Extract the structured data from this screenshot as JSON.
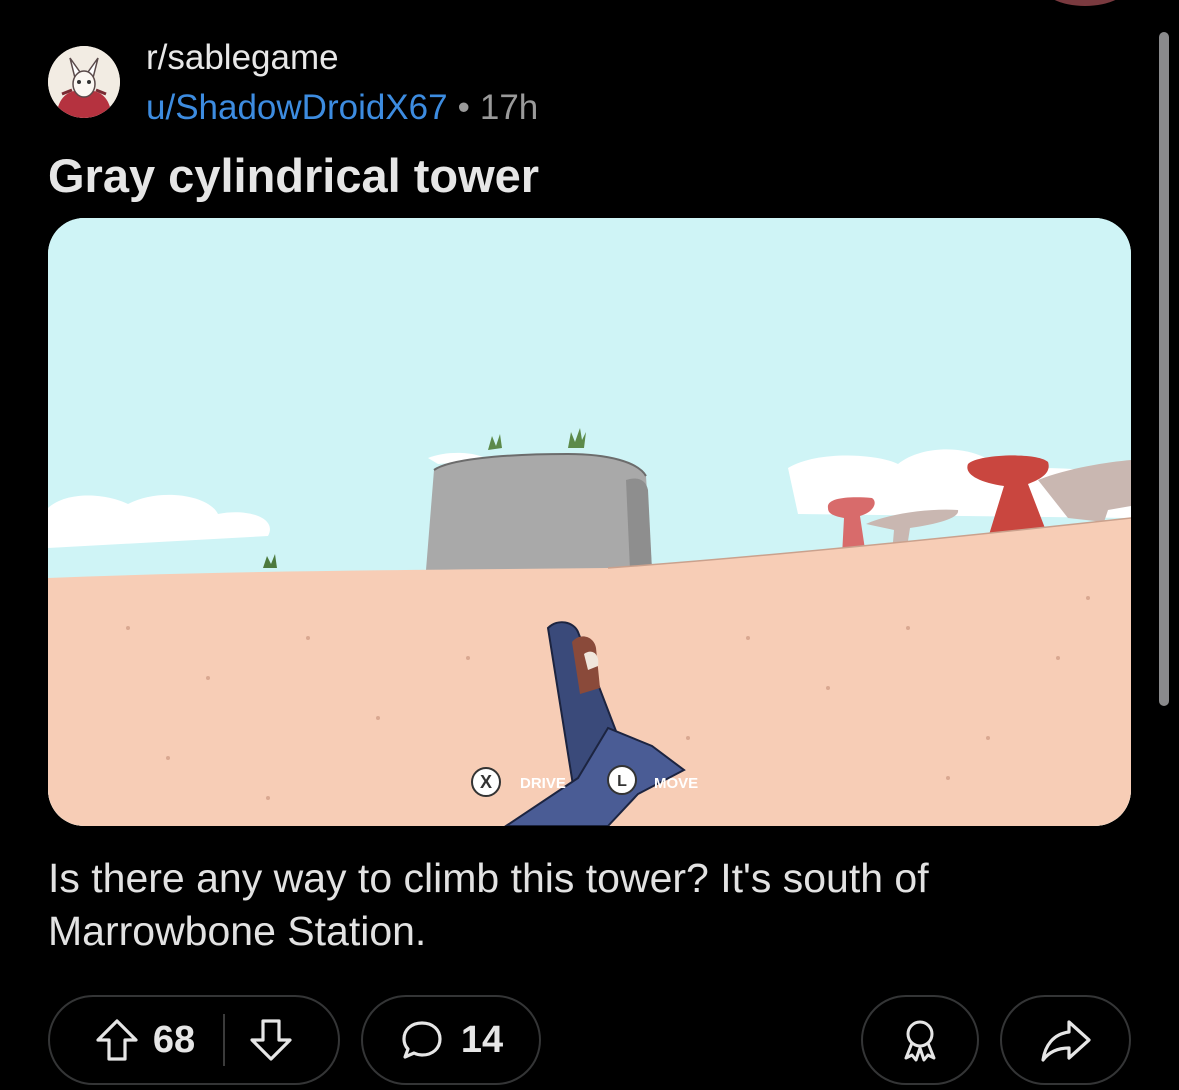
{
  "post": {
    "subreddit": "r/sablegame",
    "author": "u/ShadowDroidX67",
    "separator": "•",
    "age": "17h",
    "title": "Gray cylindrical tower",
    "body": "Is there any way to climb this tower? It's south of Marrowbone Station."
  },
  "image": {
    "hud": {
      "drive_button_glyph": "X",
      "drive_label": "DRIVE",
      "move_button_glyph": "L",
      "move_label": "MOVE"
    }
  },
  "actions": {
    "upvote_count": "68",
    "comment_count": "14"
  },
  "icons": {
    "upvote": "arrow-up-icon",
    "downvote": "arrow-down-icon",
    "comment": "speech-bubble-icon",
    "award": "award-ribbon-icon",
    "share": "share-arrow-icon"
  },
  "colors": {
    "background": "#000000",
    "username": "#3d8ce0",
    "sky": "#cff4f6",
    "sand": "#f7cdb6"
  }
}
